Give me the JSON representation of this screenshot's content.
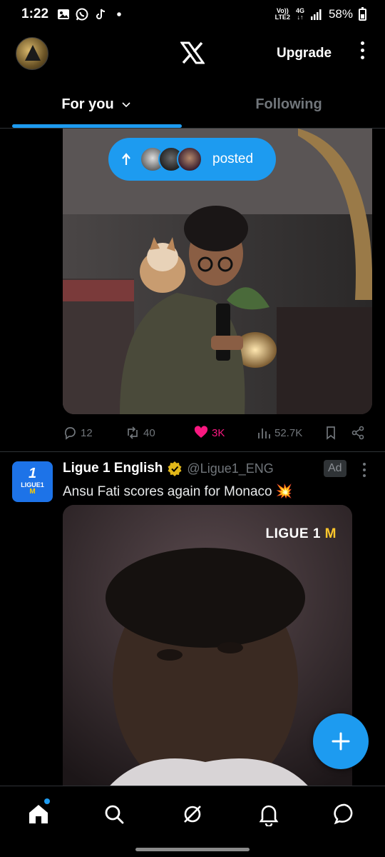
{
  "status_bar": {
    "time": "1:22",
    "notification_icons": [
      "gallery-icon",
      "whatsapp-icon",
      "tiktok-icon",
      "dot-icon"
    ],
    "network_top": "Vo))",
    "network_bottom": "LTE2",
    "network_gen": "4G",
    "battery": "58%"
  },
  "header": {
    "logo": "X",
    "upgrade_label": "Upgrade"
  },
  "tabs": [
    {
      "label": "For you",
      "active": true
    },
    {
      "label": "Following",
      "active": false
    }
  ],
  "post1": {
    "posted_pill_label": "posted",
    "actions": {
      "replies": "12",
      "reposts": "40",
      "likes": "3K",
      "views": "52.7K"
    }
  },
  "post2": {
    "avatar_line1": "1",
    "avatar_line2": "LIGUE1",
    "avatar_line3": "M",
    "name": "Ligue 1 English",
    "handle": "@Ligue1_ENG",
    "badge": "Ad",
    "text": "Ansu Fati scores again for Monaco",
    "emoji": "💥",
    "video_logo_main": "LIGUE",
    "video_logo_num": "1",
    "video_logo_mc": "M"
  },
  "colors": {
    "accent": "#1d9bf0",
    "like": "#f91880",
    "muted": "#71767b"
  }
}
